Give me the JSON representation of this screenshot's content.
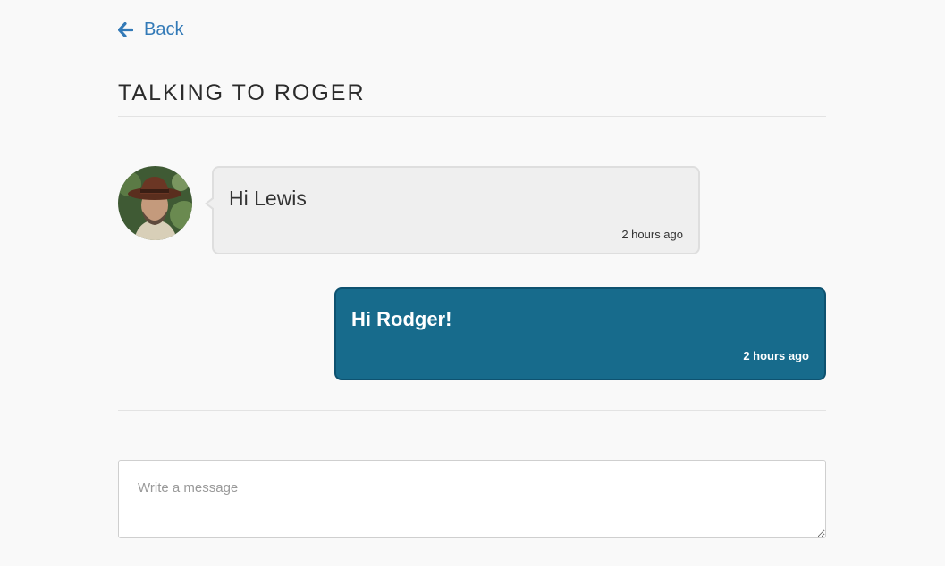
{
  "nav": {
    "back_label": "Back"
  },
  "header": {
    "title": "TALKING TO ROGER"
  },
  "messages": [
    {
      "direction": "incoming",
      "text": "Hi Lewis",
      "time": "2 hours ago"
    },
    {
      "direction": "outgoing",
      "text": "Hi Rodger!",
      "time": "2 hours ago"
    }
  ],
  "composer": {
    "placeholder": "Write a message",
    "value": ""
  },
  "colors": {
    "link": "#337ab7",
    "outgoing_bubble": "#176b8c",
    "incoming_bubble": "#efefef",
    "background": "#f9f9f9"
  },
  "icons": {
    "back": "arrow-left-icon",
    "avatar": "avatar"
  }
}
